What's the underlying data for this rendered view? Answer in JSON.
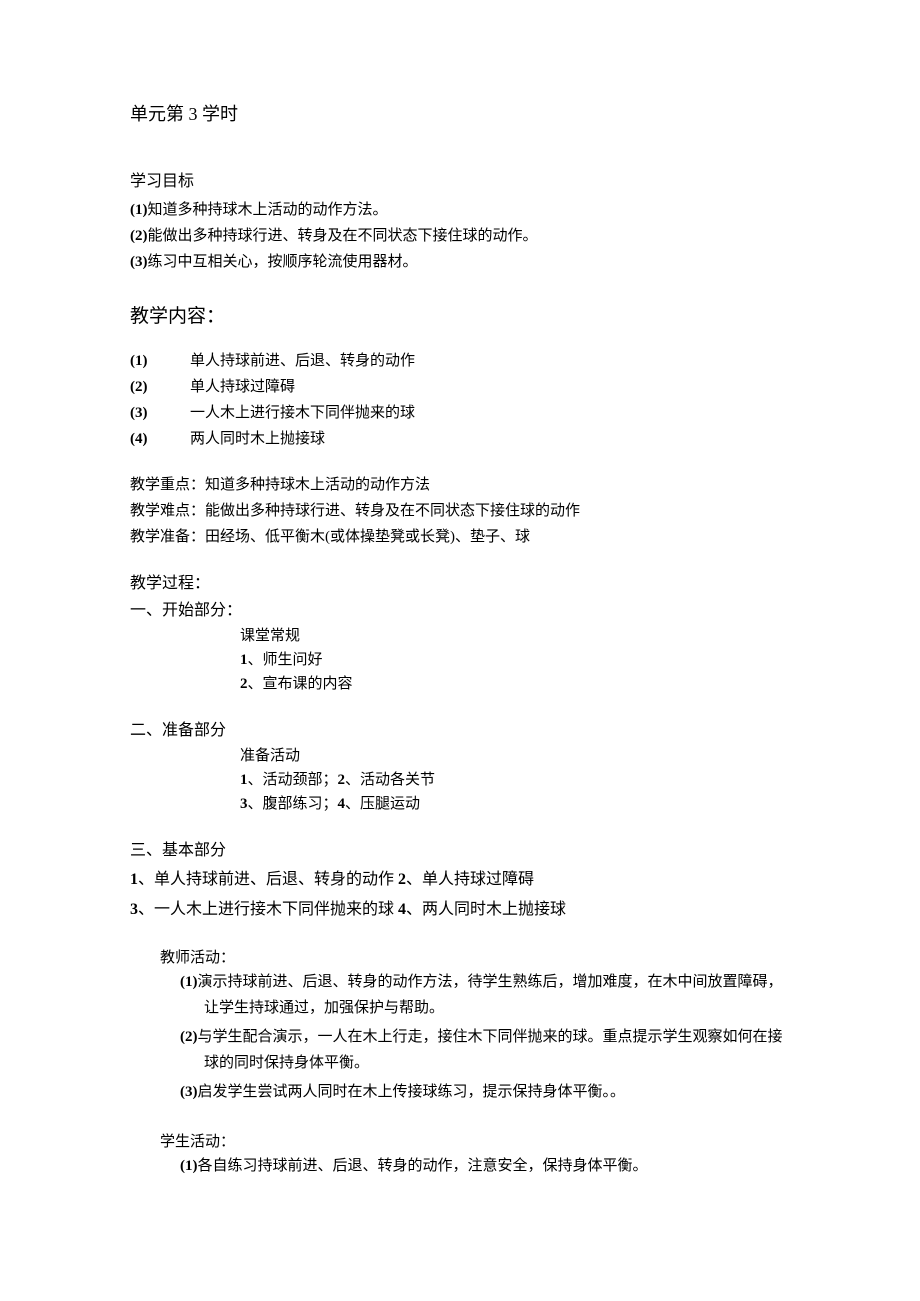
{
  "title": "单元第 3 学时",
  "goals": {
    "heading": "学习目标",
    "items": [
      {
        "marker": "(1)",
        "text": "知道多种持球木上活动的动作方法。"
      },
      {
        "marker": "(2)",
        "text": "能做出多种持球行进、转身及在不同状态下接住球的动作。"
      },
      {
        "marker": "(3)",
        "text": "练习中互相关心，按顺序轮流使用器材。"
      }
    ]
  },
  "content": {
    "heading": "教学内容：",
    "items": [
      {
        "marker": "(1)",
        "text": "单人持球前进、后退、转身的动作"
      },
      {
        "marker": "(2)",
        "text": "单人持球过障碍"
      },
      {
        "marker": "(3)",
        "text": "一人木上进行接木下同伴抛来的球"
      },
      {
        "marker": "(4)",
        "text": "两人同时木上抛接球"
      }
    ]
  },
  "emphasis": {
    "focus_label": "教学重点：",
    "focus_text": "知道多种持球木上活动的动作方法",
    "difficulty_label": "教学难点：",
    "difficulty_text": "能做出多种持球行进、转身及在不同状态下接住球的动作",
    "prep_label": "教学准备：",
    "prep_text": "田经场、低平衡木(或体操垫凳或长凳)、垫子、球"
  },
  "process": {
    "heading": "教学过程：",
    "part1": {
      "heading": "一、开始部分：",
      "sub": "课堂常规",
      "items": [
        {
          "marker": "1",
          "text": "、师生问好"
        },
        {
          "marker": "2",
          "text": "、宣布课的内容"
        }
      ]
    },
    "part2": {
      "heading": "二、准备部分",
      "sub": "准备活动",
      "line1_a": "1",
      "line1_at": "、活动颈部；",
      "line1_b": "2",
      "line1_bt": "、活动各关节",
      "line2_a": "3",
      "line2_at": "、腹部练习；",
      "line2_b": "4",
      "line2_bt": "、压腿运动"
    },
    "part3": {
      "heading": "三、基本部分",
      "line1_a": "1",
      "line1_at": "、单人持球前进、后退、转身的动作 ",
      "line1_b": "2",
      "line1_bt": "、单人持球过障碍",
      "line2_a": "3",
      "line2_at": "、一人木上进行接木下同伴抛来的球 ",
      "line2_b": "4",
      "line2_bt": "、两人同时木上抛接球"
    },
    "teacher": {
      "heading": "教师活动：",
      "items": [
        {
          "marker": "(1)",
          "text": "演示持球前进、后退、转身的动作方法，待学生熟练后，增加难度，在木中间放置障碍，让学生持球通过，加强保护与帮助。"
        },
        {
          "marker": "(2)",
          "text": "与学生配合演示，一人在木上行走，接住木下同伴抛来的球。重点提示学生观察如何在接球的同时保持身体平衡。"
        },
        {
          "marker": "(3)",
          "text": "启发学生尝试两人同时在木上传接球练习，提示保持身体平衡。。"
        }
      ]
    },
    "student": {
      "heading": "学生活动：",
      "items": [
        {
          "marker": "(1)",
          "text": "各自练习持球前进、后退、转身的动作，注意安全，保持身体平衡。"
        }
      ]
    }
  }
}
